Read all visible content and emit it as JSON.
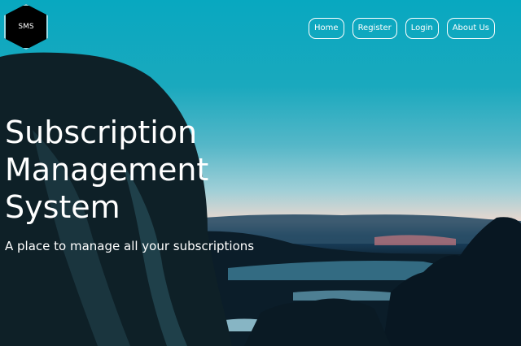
{
  "logo": {
    "text": "SMS"
  },
  "nav": {
    "home": "Home",
    "register": "Register",
    "login": "Login",
    "about": "About Us"
  },
  "hero": {
    "title_line1": "Subscription",
    "title_line2": "Management",
    "title_line3": "System",
    "tagline": "A place to manage all your subscriptions"
  }
}
